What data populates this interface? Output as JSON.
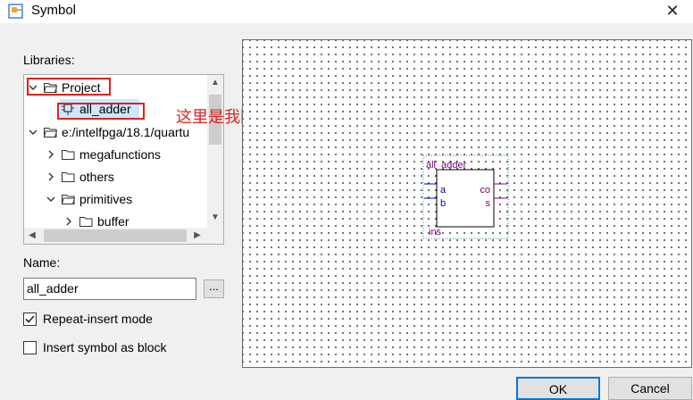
{
  "window": {
    "title": "Symbol",
    "close_glyph": "✕"
  },
  "libraries": {
    "label": "Libraries:",
    "items": [
      {
        "label": "Project",
        "icon": "folder-open-icon"
      },
      {
        "label": "all_adder",
        "icon": "symbol-icon"
      },
      {
        "label": "e:/intelfpga/18.1/quartu",
        "icon": "folder-open-icon"
      },
      {
        "label": "megafunctions",
        "icon": "folder-icon"
      },
      {
        "label": "others",
        "icon": "folder-icon"
      },
      {
        "label": "primitives",
        "icon": "folder-open-icon"
      },
      {
        "label": "buffer",
        "icon": "folder-icon"
      }
    ]
  },
  "annotation": "这里是我刚刚输错了名字嘿嘿嘿",
  "name": {
    "label": "Name:",
    "value": "all_adder",
    "browse_label": "..."
  },
  "options": {
    "repeat_insert": {
      "label": "Repeat-insert mode",
      "checked": true
    },
    "insert_as_block": {
      "label": "Insert symbol as block",
      "checked": false
    }
  },
  "symbol": {
    "name": "all_adder",
    "inputs": [
      "a",
      "b"
    ],
    "outputs": [
      "co",
      "s"
    ],
    "instance": "ins"
  },
  "buttons": {
    "ok": "OK",
    "cancel": "Cancel"
  },
  "colors": {
    "annotation_red": "#e02020",
    "symbol_purple": "#800080",
    "pin_blue": "#0000c0"
  }
}
